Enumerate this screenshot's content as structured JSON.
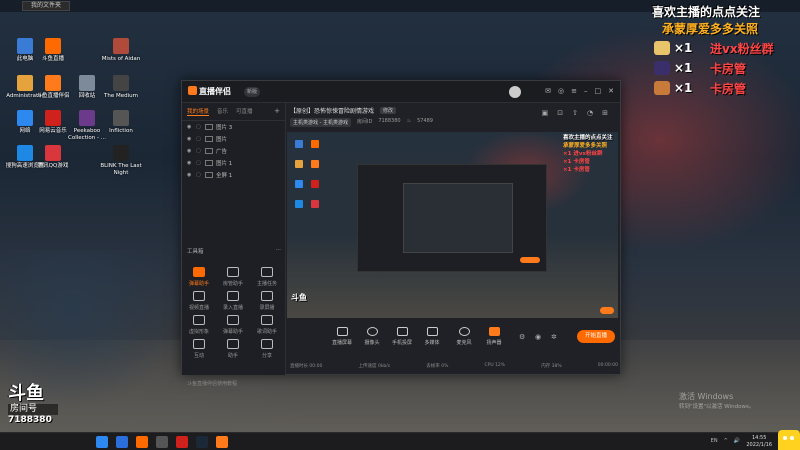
{
  "topbar": {
    "tab_label": "我的文件夹"
  },
  "desktop_icons": [
    {
      "label": "此电脑",
      "color": "#3a7bd5"
    },
    {
      "label": "斗鱼直播",
      "color": "#ff6a00"
    },
    {
      "label": "Mists of Aidan",
      "color": "#b04a3a"
    },
    {
      "label": "Administrator",
      "color": "#e6a23c"
    },
    {
      "label": "斗鱼直播伴侣",
      "color": "#ff7a1a"
    },
    {
      "label": "回收站",
      "color": "#7d8a99"
    },
    {
      "label": "The Medium",
      "color": "#444"
    },
    {
      "label": "网络",
      "color": "#2d89ef"
    },
    {
      "label": "网易云音乐",
      "color": "#d0211c"
    },
    {
      "label": "Peekaboo Collection - ...",
      "color": "#6c3a8a"
    },
    {
      "label": "Infliction",
      "color": "#555"
    },
    {
      "label": "搜狗高速浏览器",
      "color": "#1e88e5"
    },
    {
      "label": "腾讯QQ游戏",
      "color": "#d9363e"
    },
    {
      "label": "BLINK The Last Night",
      "color": "#222"
    }
  ],
  "overlay": {
    "title": "喜欢主播的点点关注",
    "subtitle": "承蒙厚爱多多关照",
    "rows": [
      {
        "count": "×1",
        "desc": "进vx粉丝群",
        "badge_color": "#e8c56a"
      },
      {
        "count": "×1",
        "desc": "卡房管",
        "badge_color": "#3b2f6b"
      },
      {
        "count": "×1",
        "desc": "卡房管",
        "badge_color": "#c87a3a"
      }
    ]
  },
  "app": {
    "logo": "直播伴侣",
    "version_badge": "新版",
    "scene_tabs": [
      "我的场景",
      "音乐",
      "可直播",
      "+"
    ],
    "sources": [
      "图片 3",
      "图片",
      "广告",
      "图片 1",
      "全屏 1"
    ],
    "tools_title": "工具箱",
    "tools": [
      "弹幕助手",
      "房管助手",
      "主播任务",
      "视频直播",
      "录入直播",
      "录屏播",
      "虚拟形象",
      "弹幕助手",
      "歌词助手",
      "互动",
      "助手",
      "分享"
    ],
    "status_left": "斗鱼直播伴侣使用教程",
    "room_title": "【原创】恐怖惊悚冒险剧情游戏",
    "room_tag": "修改",
    "info_chip": "主机类游戏 - 主机类游戏",
    "room_id_label": "房间ID",
    "room_id": "7188380",
    "heat": "57489",
    "bottom_buttons": [
      "直播屏幕",
      "摄像头",
      "手机投屏",
      "多媒体",
      "麦克风",
      "扬声器"
    ],
    "live_button": "开始直播",
    "status_bar": [
      "直播时长 00:00",
      "上传速度 0kb/s",
      "丢帧率 0%",
      "CPU 12%",
      "内存 38%",
      "00:00:00"
    ]
  },
  "preview_overlay": {
    "title": "喜欢主播的点点关注",
    "subtitle": "承蒙厚爱多多关照",
    "rows": [
      "×1 进vx粉丝群",
      "×1 卡房管",
      "×1 卡房管"
    ]
  },
  "corner_logo": {
    "brand": "斗鱼",
    "room_label": "房间号",
    "room_number": "7188380"
  },
  "watermark": {
    "line1": "激活 Windows",
    "line2": "转到\"设置\"以激活 Windows。"
  },
  "taskbar": {
    "time": "14:55",
    "date": "2022/1/16",
    "tray": [
      "EN",
      "^",
      "🔊"
    ]
  }
}
